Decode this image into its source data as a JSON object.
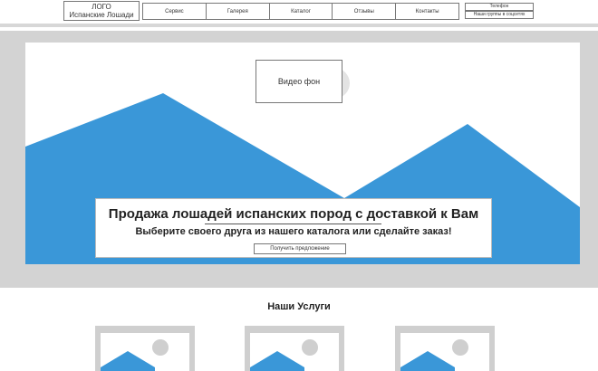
{
  "header": {
    "logo_line1": "ЛОГО",
    "logo_line2": "Испанские Лошади",
    "nav": [
      "Сервис",
      "Галерея",
      "Каталог",
      "Отзывы",
      "Контакты"
    ],
    "phone_label": "Телефон",
    "social_label": "Наши группы в соцсетях"
  },
  "hero": {
    "video_label": "Видео фон",
    "title": "Продажа лошадей испанских пород с доставкой к Вам",
    "subtitle": "Выберите своего друга из нашего каталога или сделайте заказ!",
    "offer_button": "Получить предложение",
    "mountain_color": "#3a97d8"
  },
  "services": {
    "title": "Наши Услуги",
    "image_placeholder_icon": "image-placeholder-icon"
  }
}
